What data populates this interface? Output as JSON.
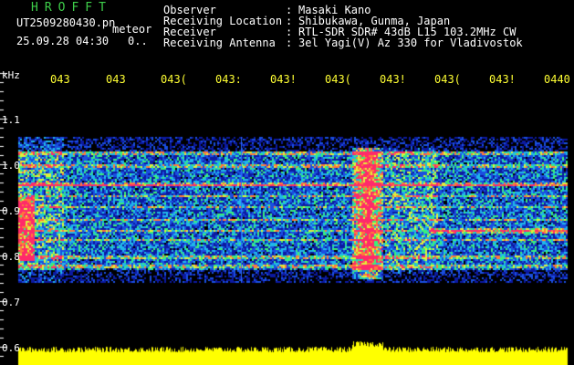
{
  "header": {
    "logo": "HROFFT",
    "filename": "UT2509280430.pn",
    "meteor_label": "meteor",
    "datetime": "25.09.28 04:30",
    "count": "0.."
  },
  "info": [
    {
      "label": "Observer",
      "value": "Masaki Kano"
    },
    {
      "label": "Receiving Location",
      "value": "Shibukawa, Gunma, Japan"
    },
    {
      "label": "Receiver",
      "value": "RTL-SDR SDR# 43dB L15 103.2MHz CW"
    },
    {
      "label": "Receiving Antenna",
      "value": "3el Yagi(V) Az 330 for Vladivostok"
    }
  ],
  "axis": {
    "unit": "kHz",
    "time_ticks": [
      "043",
      "043",
      "043(",
      "043:",
      "043!",
      "043(",
      "043!",
      "043(",
      "043!",
      "0440"
    ],
    "freq_ticks": [
      "1.1",
      "1.0",
      "0.9",
      "0.8",
      "0.7",
      "0.6"
    ]
  },
  "colors": {
    "background": "#000000",
    "text": "#ffffff",
    "tick": "#ffff33",
    "logo": "#3ecf4a",
    "signal_strong": "#ff2a6a",
    "signal_weak": "#1a2fd0",
    "noise_trace": "#ffff00"
  }
}
